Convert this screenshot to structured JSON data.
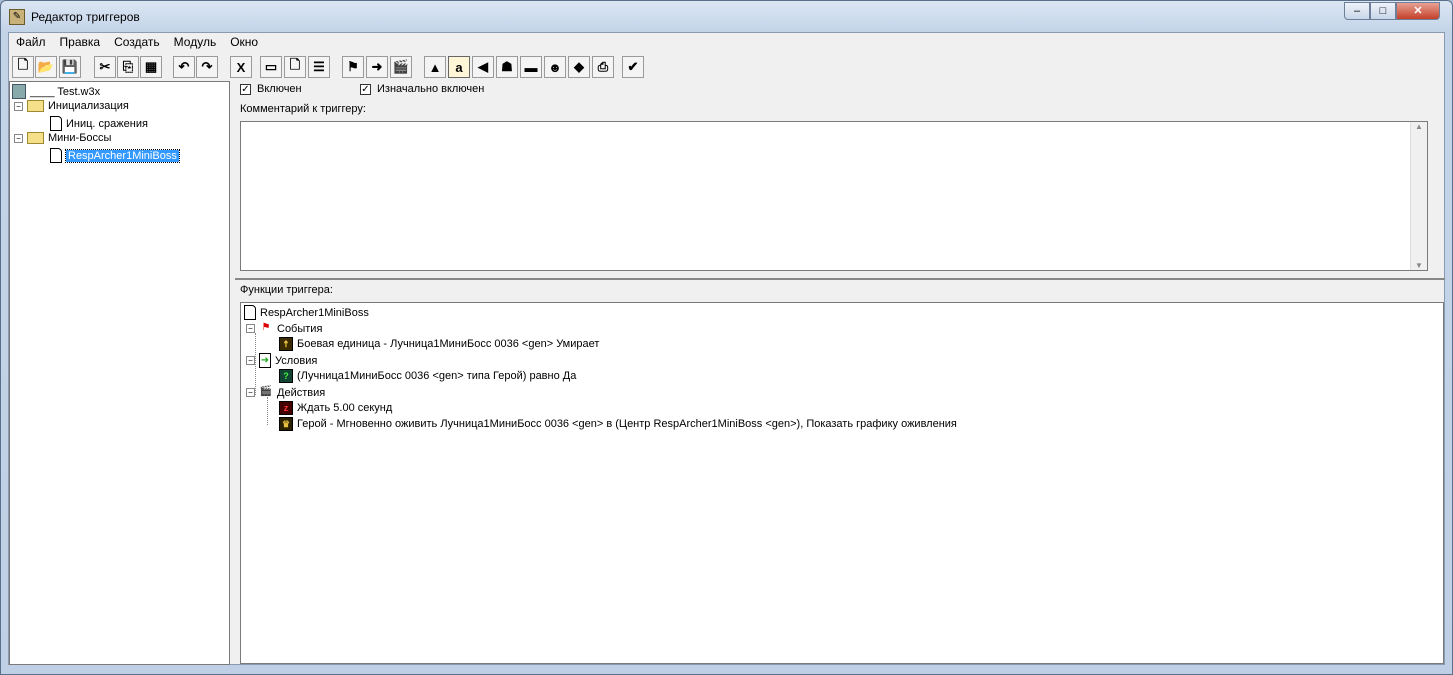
{
  "window": {
    "title": "Редактор триггеров",
    "minimize": "‒",
    "maximize": "□",
    "close": "✕"
  },
  "menu": [
    "Файл",
    "Правка",
    "Создать",
    "Модуль",
    "Окно"
  ],
  "toolbar": [
    {
      "name": "new-icon",
      "glyph": "🗋"
    },
    {
      "name": "open-icon",
      "glyph": "📂"
    },
    {
      "name": "save-icon",
      "glyph": "💾"
    },
    {
      "name": "cut-icon",
      "glyph": "✂"
    },
    {
      "name": "copy-icon",
      "glyph": "⎘"
    },
    {
      "name": "paste-icon",
      "glyph": "▦"
    },
    {
      "name": "undo-icon",
      "glyph": "↶"
    },
    {
      "name": "redo-icon",
      "glyph": "↷"
    },
    {
      "name": "delete-icon",
      "glyph": "X"
    },
    {
      "name": "new-category-icon",
      "glyph": "▭"
    },
    {
      "name": "new-trigger-icon",
      "glyph": "🗋"
    },
    {
      "name": "variables-icon",
      "glyph": "☰"
    },
    {
      "name": "new-event-icon",
      "glyph": "⚑"
    },
    {
      "name": "new-condition-icon",
      "glyph": "➜"
    },
    {
      "name": "new-action-icon",
      "glyph": "🎬"
    },
    {
      "name": "terrain-editor-icon",
      "glyph": "▲"
    },
    {
      "name": "trigger-editor-icon",
      "glyph": "a"
    },
    {
      "name": "sound-editor-icon",
      "glyph": "◀"
    },
    {
      "name": "object-editor-icon",
      "glyph": "☗"
    },
    {
      "name": "campaign-editor-icon",
      "glyph": "▬"
    },
    {
      "name": "ai-editor-icon",
      "glyph": "☻"
    },
    {
      "name": "object-manager-icon",
      "glyph": "◆"
    },
    {
      "name": "import-manager-icon",
      "glyph": "⎙"
    },
    {
      "name": "test-map-icon",
      "glyph": "✔"
    }
  ],
  "tree": {
    "root": "____ Test.w3x",
    "items": [
      {
        "label": "Инициализация",
        "type": "folder"
      },
      {
        "label": "Иниц. сражения",
        "type": "trigger"
      },
      {
        "label": "Мини-Боссы",
        "type": "folder"
      },
      {
        "label": "RespArcher1MiniBoss",
        "type": "trigger",
        "selected": true
      }
    ]
  },
  "trigger": {
    "enabled_label": "Включен",
    "enabled": true,
    "initially_on_label": "Изначально включен",
    "initially_on": true,
    "comment_label": "Комментарий к триггеру:",
    "comment": "",
    "functions_label": "Функции триггера:",
    "name": "RespArcher1MiniBoss",
    "events_label": "События",
    "events": [
      "Боевая единица - Лучница1МиниБосс 0036 <gen> Умирает"
    ],
    "conditions_label": "Условия",
    "conditions": [
      "(Лучница1МиниБосс 0036 <gen> типа Герой) равно Да"
    ],
    "actions_label": "Действия",
    "actions": [
      "Ждать 5.00 секунд",
      "Герой - Мгновенно оживить Лучница1МиниБосс 0036 <gen> в (Центр RespArcher1MiniBoss <gen>), Показать графику оживления"
    ]
  }
}
